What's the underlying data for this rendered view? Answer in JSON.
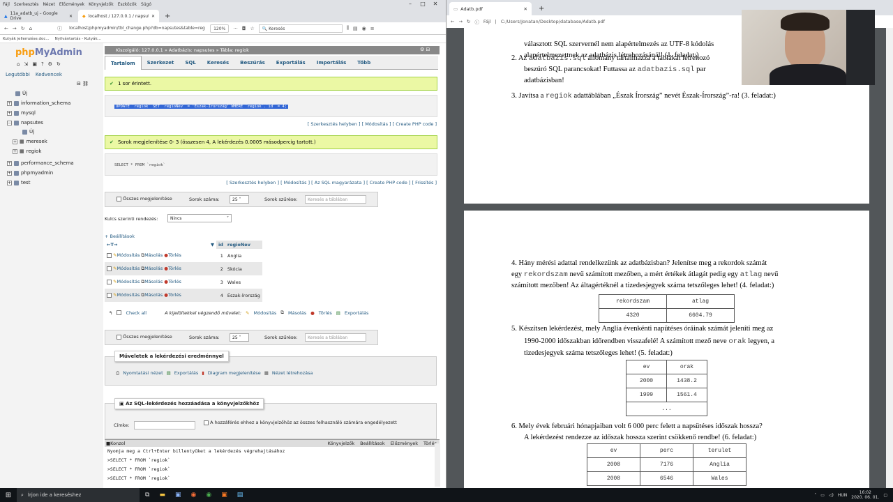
{
  "left_browser": {
    "menu": [
      "Fájl",
      "Szerkesztés",
      "Nézet",
      "Előzmények",
      "Könyvjelzők",
      "Eszközök",
      "Súgó"
    ],
    "tabs": [
      "11a_adatb_uj – Google Drive",
      "localhost / 127.0.0.1 / napsutes"
    ],
    "url": "localhost/phpmyadmin/tbl_change.php?db=napsutes&table=reg",
    "zoom": "120%",
    "search_placeholder": "Keresés",
    "bookmarks": [
      "Kutyák jellemzése.doc...",
      "Nyilvántartás - Kutyák..."
    ]
  },
  "pma_sidebar": {
    "logo_a": "php",
    "logo_b": "MyAdmin",
    "recent": "Legutóbbi",
    "favorites": "Kedvencek",
    "tree": [
      "Új",
      "information_schema",
      "mysql",
      "napsutes",
      "Új",
      "meresek",
      "regiok",
      "performance_schema",
      "phpmyadmin",
      "test"
    ]
  },
  "pma_main": {
    "breadcrumb": "Kiszolgáló: 127.0.0.1 » Adatbázis: napsutes » Tábla: regiok",
    "tabs": [
      "Tartalom",
      "Szerkezet",
      "SQL",
      "Keresés",
      "Beszúrás",
      "Exportálás",
      "Importálás",
      "Több"
    ],
    "msg1": "1 sor érintett.",
    "sql1": "UPDATE `regiok` SET `regioNev` = 'Észak-Írország' WHERE `regiok`.`id` = 4;",
    "links1": "[ Szerkesztés helyben ] [ Módosítás ] [ Create PHP code ]",
    "msg2": "Sorok megjelenítése 0- 3 (összesen 4, A lekérdezés 0.0005 másodpercig tartott.)",
    "sql2": "SELECT * FROM `regiok`",
    "links2": "[ Szerkesztés helyben ] [ Módosítás ] [ Az SQL magyarázata ] [ Create PHP code ] [ Frissítés ]",
    "show_all": "Összes megjelenítése",
    "rows_label": "Sorok száma:",
    "rows_value": "25",
    "filter_label": "Sorok szűrése:",
    "filter_placeholder": "Keresés a táblában",
    "sort_label": "Kulcs szerinti rendezés:",
    "sort_value": "Nincs",
    "options": "+ Beállítások",
    "col_id": "id",
    "col_name": "regioNev",
    "edit": "Módosítás",
    "copy": "Másolás",
    "delete": "Törlés",
    "rows": [
      {
        "id": "1",
        "name": "Anglia"
      },
      {
        "id": "2",
        "name": "Skócia"
      },
      {
        "id": "3",
        "name": "Wales"
      },
      {
        "id": "4",
        "name": "Észak-Írország"
      }
    ],
    "check_all": "Check all",
    "with_selected": "A kijelöltekkel végzendő művelet:",
    "export": "Exportálás",
    "ops_title": "Műveletek a lekérdezési eredménnyel",
    "ops": [
      "Nyomtatási nézet",
      "Exportálás",
      "Diagram megjelenítése",
      "Nézet létrehozása"
    ],
    "bm_title": "Az SQL-lekérdezés hozzáadása a könyvjelzőkhöz",
    "label": "Címke:",
    "allow_all": "A hozzáférés ehhez a könyvjelzőhöz az összes felhasználó számára engedélyezett",
    "console": {
      "title": "Konzol",
      "links": [
        "Könyvjelzők",
        "Beállítások",
        "Előzmények",
        "Törlés"
      ],
      "hint": "Nyomja meg a Ctrl+Enter billentyűket a lekérdezés végrehajtásához",
      "lines": [
        "SELECT * FROM `regiok`",
        "SELECT * FROM `regiok`",
        "SELECT * FROM `regiok`"
      ]
    }
  },
  "right_browser": {
    "tab": "Adatb.pdf",
    "url_prefix": "Fájl",
    "url": "C:/Users/Jonatan/Desktop/database/Adatb.pdf",
    "p1_l1": "választott SQL szervernél nem alapértelmezés az UTF-8 kódolás",
    "p1_l2": "alapértelmezettnek az adatbázis létrehozásánál! (1. feladat:)",
    "p2_l1a": "2.  Az ",
    "p2_l1b": "adatbazis.sql",
    "p2_l1c": " állomány tartalmazza a táblákat létrehozó",
    "p2_l2a": "beszúró SQL parancsokat! Futtassa az ",
    "p2_l2b": "adatbazis.sql",
    "p2_l2c": " par",
    "p2_l3": "adatbázisban!",
    "p3a": "3.  Javítsa a ",
    "p3b": "regiok",
    "p3c": " adattáblában „Észak Írország” nevét Észak-Írország”-ra! (3. feladat:)",
    "q4_l1": "4.      Hány mérési adattal rendelkezünk az adatbázisban? Jelenítse meg a rekordok számát",
    "q4_l2a": "egy ",
    "q4_l2b": "rekordszam",
    "q4_l2c": " nevű számított mezőben, a mért értékek átlagát pedig egy ",
    "q4_l2d": "atlag",
    "q4_l2e": " nevű",
    "q4_l3": "számított mezőben! Az áltagértéknél a tizedesjegyek száma tetszőleges lehet! (4. feladat:)",
    "t4_head": [
      "rekordszam",
      "atlag"
    ],
    "t4_row": [
      "4320",
      "6604.79"
    ],
    "q5_l1": "5.  Készítsen lekérdezést, mely Anglia évenkénti napütéses óráinak számát jeleníti meg az",
    "q5_l2a": "1990-2000 időszakban időrendben visszafelé! A számított mező neve ",
    "q5_l2b": "orak",
    "q5_l2c": " legyen, a",
    "q5_l3": "tizedesjegyek száma tetszőleges lehet! (5. feladat:)",
    "t5_head": [
      "ev",
      "orak"
    ],
    "t5_rows": [
      [
        "2000",
        "1438.2"
      ],
      [
        "1999",
        "1561.4"
      ],
      [
        "...",
        ""
      ]
    ],
    "q6_l1": "6.  Mely évek februári hónapjaiban volt 6 000 perc felett a napsütéses időszak hossza?",
    "q6_l2": "A lekérdezést rendezze az időszak hossza szerint csökkenő rendbe! (6. feladat:)",
    "t6_head": [
      "ev",
      "perc",
      "terulet"
    ],
    "t6_rows": [
      [
        "2008",
        "7176",
        "Anglia"
      ],
      [
        "2008",
        "6546",
        "Wales"
      ]
    ]
  },
  "taskbar": {
    "search": "Írjon ide a kereséshez",
    "lang": "HUN",
    "time": "16:02",
    "date": "2020. 06. 01."
  }
}
